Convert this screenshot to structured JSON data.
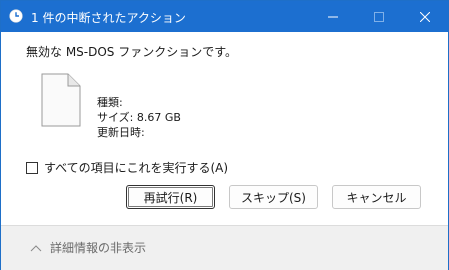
{
  "window": {
    "title": "1 件の中断されたアクション",
    "accent_color": "#1c6fd0"
  },
  "main": {
    "message": "無効な MS-DOS ファンクションです。",
    "file": {
      "icon": "blank-file-icon",
      "type_label": "種類:",
      "size_label": "サイズ: 8.67 GB",
      "modified_label": "更新日時:"
    },
    "apply_all_label": "すべての項目にこれを実行する(A)",
    "buttons": {
      "retry": "再試行(R)",
      "skip": "スキップ(S)",
      "cancel": "キャンセル"
    }
  },
  "footer": {
    "details_label": "詳細情報の非表示"
  }
}
